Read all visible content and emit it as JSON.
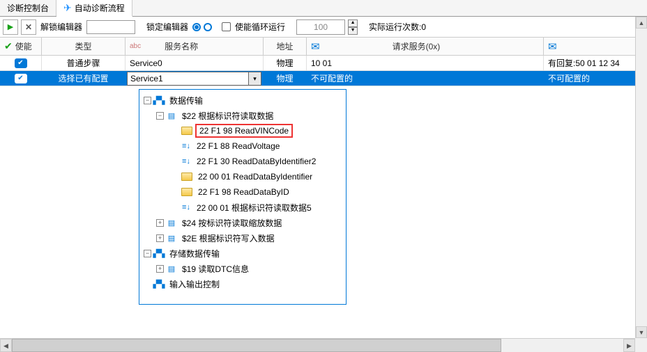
{
  "tabs": {
    "console": "诊断控制台",
    "flow": "自动诊断流程"
  },
  "toolbar": {
    "unlock": "解锁编辑器",
    "lock": "锁定编辑器",
    "loop": "使能循环运行",
    "count": "100",
    "actual": "实际运行次数:0"
  },
  "headers": {
    "enable": "使能",
    "type": "类型",
    "service": "服务名称",
    "addr": "地址",
    "req": "请求服务(0x)"
  },
  "rows": [
    {
      "type": "普通步骤",
      "service": "Service0",
      "addr": "物理",
      "req": "10 01",
      "resp": "有回复:50 01 12 34"
    },
    {
      "type": "选择已有配置",
      "service": "Service1",
      "addr": "物理",
      "req": "不可配置的",
      "resp": "不可配置的"
    }
  ],
  "tree": {
    "n0": "数据传输",
    "n1": "$22 根据标识符读取数据",
    "n2": "22 F1 98 ReadVINCode",
    "n3": "22 F1 88 ReadVoltage",
    "n4": "22 F1 30 ReadDataByIdentifier2",
    "n5": "22 00 01 ReadDataByIdentifier",
    "n6": "22 F1 98 ReadDataByID",
    "n7": "22 00 01 根据标识符读取数据5",
    "n8": "$24 按标识符读取缩放数据",
    "n9": "$2E 根据标识符写入数据",
    "n10": "存储数据传输",
    "n11": "$19 读取DTC信息",
    "n12": "输入输出控制"
  }
}
